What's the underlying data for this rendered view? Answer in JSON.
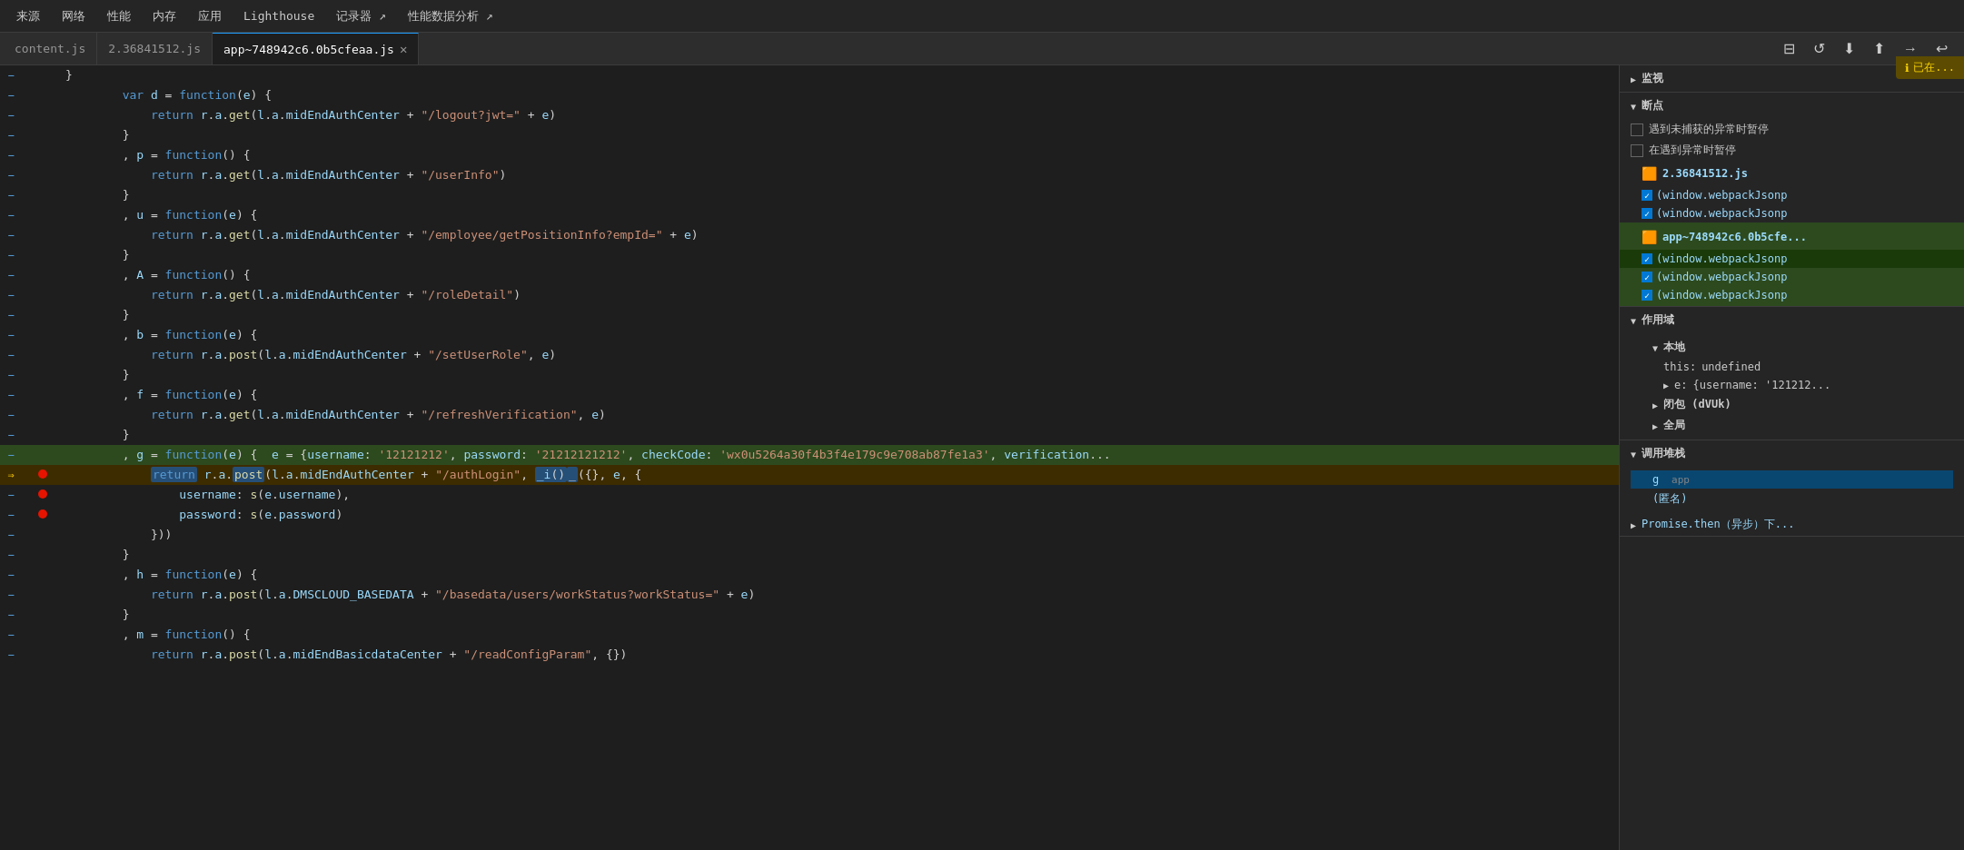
{
  "nav": {
    "items": [
      "来源",
      "网络",
      "性能",
      "内存",
      "应用",
      "Lighthouse",
      "记录器 ↗",
      "性能数据分析 ↗"
    ]
  },
  "tabs": [
    {
      "id": "content-js",
      "label": "content.js",
      "active": false,
      "closable": false
    },
    {
      "id": "2-36841512-js",
      "label": "2.36841512.js",
      "active": false,
      "closable": false
    },
    {
      "id": "app-748942c6",
      "label": "app~748942c6.0b5cfeaa.js",
      "active": true,
      "closable": true
    }
  ],
  "toolbar": {
    "icons": [
      "⊟",
      "↺",
      "⬇",
      "⬆",
      "→",
      "↩"
    ]
  },
  "info_badge": {
    "icon": "ℹ",
    "text": "已在..."
  },
  "code_lines": [
    {
      "arrow": "-",
      "content": "        }"
    },
    {
      "arrow": "-",
      "content": "        var d = function(e) {"
    },
    {
      "arrow": "-",
      "content": "            return r.a.get(l.a.midEndAuthCenter + \"/logout?jwt=\" + e)"
    },
    {
      "arrow": "-",
      "content": "        }"
    },
    {
      "arrow": "-",
      "content": "        , p = function() {"
    },
    {
      "arrow": "-",
      "content": "            return r.a.get(l.a.midEndAuthCenter + \"/userInfo\")"
    },
    {
      "arrow": "-",
      "content": "        }"
    },
    {
      "arrow": "-",
      "content": "        , u = function(e) {"
    },
    {
      "arrow": "-",
      "content": "            return r.a.get(l.a.midEndAuthCenter + \"/employee/getPositionInfo?empId=\" + e)"
    },
    {
      "arrow": "-",
      "content": "        }"
    },
    {
      "arrow": "-",
      "content": "        , A = function() {"
    },
    {
      "arrow": "-",
      "content": "            return r.a.get(l.a.midEndAuthCenter + \"/roleDetail\")"
    },
    {
      "arrow": "-",
      "content": "        }"
    },
    {
      "arrow": "-",
      "content": "        , b = function(e) {"
    },
    {
      "arrow": "-",
      "content": "            return r.a.post(l.a.midEndAuthCenter + \"/setUserRole\", e)"
    },
    {
      "arrow": "-",
      "content": "        }"
    },
    {
      "arrow": "-",
      "content": "        , f = function(e) {"
    },
    {
      "arrow": "-",
      "content": "            return r.a.get(l.a.midEndAuthCenter + \"/refreshVerification\", e)"
    },
    {
      "arrow": "-",
      "content": "        }"
    },
    {
      "arrow": "-",
      "highlight": true,
      "content": "        , g = function(e) {  e = {username: '12121212', password: '21212121212', checkCode: 'wx0u5264a30f4b3f4e179c9e708ab87fe1a3', verification..."
    },
    {
      "arrow": "→",
      "breakpoint": true,
      "active": true,
      "content": "           return r.a.post(l.a.midEndAuthCenter + \"/authLogin\", _i()_({}, e, {"
    },
    {
      "arrow": "-",
      "breakpoint": true,
      "content": "                username: s(e.username),"
    },
    {
      "arrow": "-",
      "breakpoint": true,
      "content": "                password: s(e.password)"
    },
    {
      "arrow": "-",
      "content": "            }))"
    },
    {
      "arrow": "-",
      "content": "        }"
    },
    {
      "arrow": "-",
      "content": "        , h = function(e) {"
    },
    {
      "arrow": "-",
      "content": "            return r.a.post(l.a.DMSCLOUD_BASEDATA + \"/basedata/users/workStatus?workStatus=\" + e)"
    },
    {
      "arrow": "-",
      "content": "        }"
    },
    {
      "arrow": "-",
      "content": "        , m = function() {"
    },
    {
      "arrow": "-",
      "content": "            return r.a.post(l.a.midEndBasicdataCenter + \"/readConfigParam\", {})"
    }
  ],
  "right_panel": {
    "watch": {
      "header": "监视",
      "expanded": true
    },
    "breakpoints": {
      "header": "断点",
      "expanded": true,
      "options": [
        {
          "label": "遇到未捕获的异常时暂停",
          "checked": false
        },
        {
          "label": "在遇到异常时暂停",
          "checked": false
        }
      ],
      "files": [
        {
          "name": "2.36841512.js",
          "icon": "🟠",
          "active": false,
          "entries": [
            {
              "label": "(window.webpackJsonp",
              "checked": true
            },
            {
              "label": "(window.webpackJsonp",
              "checked": true
            }
          ]
        },
        {
          "name": "app~748942c6.0b5cfe...",
          "icon": "🟠",
          "active": true,
          "entries": [
            {
              "label": "(window.webpackJsonp",
              "checked": true
            },
            {
              "label": "(window.webpackJsonp",
              "checked": true
            },
            {
              "label": "(window.webpackJsonp",
              "checked": true
            }
          ]
        }
      ]
    },
    "scope": {
      "header": "作用域",
      "expanded": true,
      "sections": [
        {
          "label": "本地",
          "expanded": true,
          "items": [
            {
              "key": "this:",
              "value": "undefined"
            },
            {
              "key": "▶ e:",
              "value": "{username: '121212..."
            }
          ]
        },
        {
          "label": "闭包 (dVUk)",
          "expanded": false
        },
        {
          "label": "全局",
          "expanded": false
        }
      ]
    },
    "call_stack": {
      "header": "调用堆栈",
      "expanded": true,
      "items": [
        {
          "label": "g",
          "sub": "app",
          "active": true
        },
        {
          "label": "(匿名)"
        }
      ]
    },
    "bottom": {
      "label": "Promise.then（异步）下...",
      "arrow": "▶"
    }
  }
}
